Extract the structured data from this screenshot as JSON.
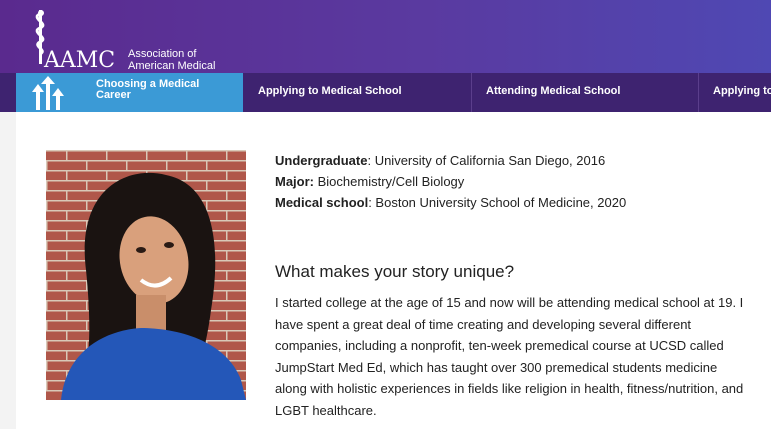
{
  "header": {
    "logo_text": "AAMC",
    "org_line1": "Association of",
    "org_line2": "American Medical Colleges"
  },
  "nav": {
    "items": [
      {
        "label": "Choosing a Medical Career"
      },
      {
        "label": "Applying to Medical School"
      },
      {
        "label": "Attending Medical School"
      },
      {
        "label": "Applying to"
      }
    ]
  },
  "profile": {
    "undergrad_label": "Undergraduate",
    "undergrad_value": ": University of California San Diego, 2016",
    "major_label": "Major:",
    "major_value": " Biochemistry/Cell Biology",
    "school_label": "Medical school",
    "school_value": ": Boston University School of Medicine, 2020"
  },
  "story": {
    "question": "What makes your story unique?",
    "answer": "I started college at the age of 15 and now will be attending medical school at 19. I have spent a great deal of time creating and developing several different companies, including a nonprofit, ten-week premedical course at UCSD called JumpStart Med Ed, which has taught over 300 premedical students medicine along with holistic experiences in fields like religion in health, fitness/nutrition, and LGBT healthcare."
  },
  "colors": {
    "header": "#5a2a8e",
    "nav": "#3e2370",
    "nav_active": "#3b9ad6"
  }
}
